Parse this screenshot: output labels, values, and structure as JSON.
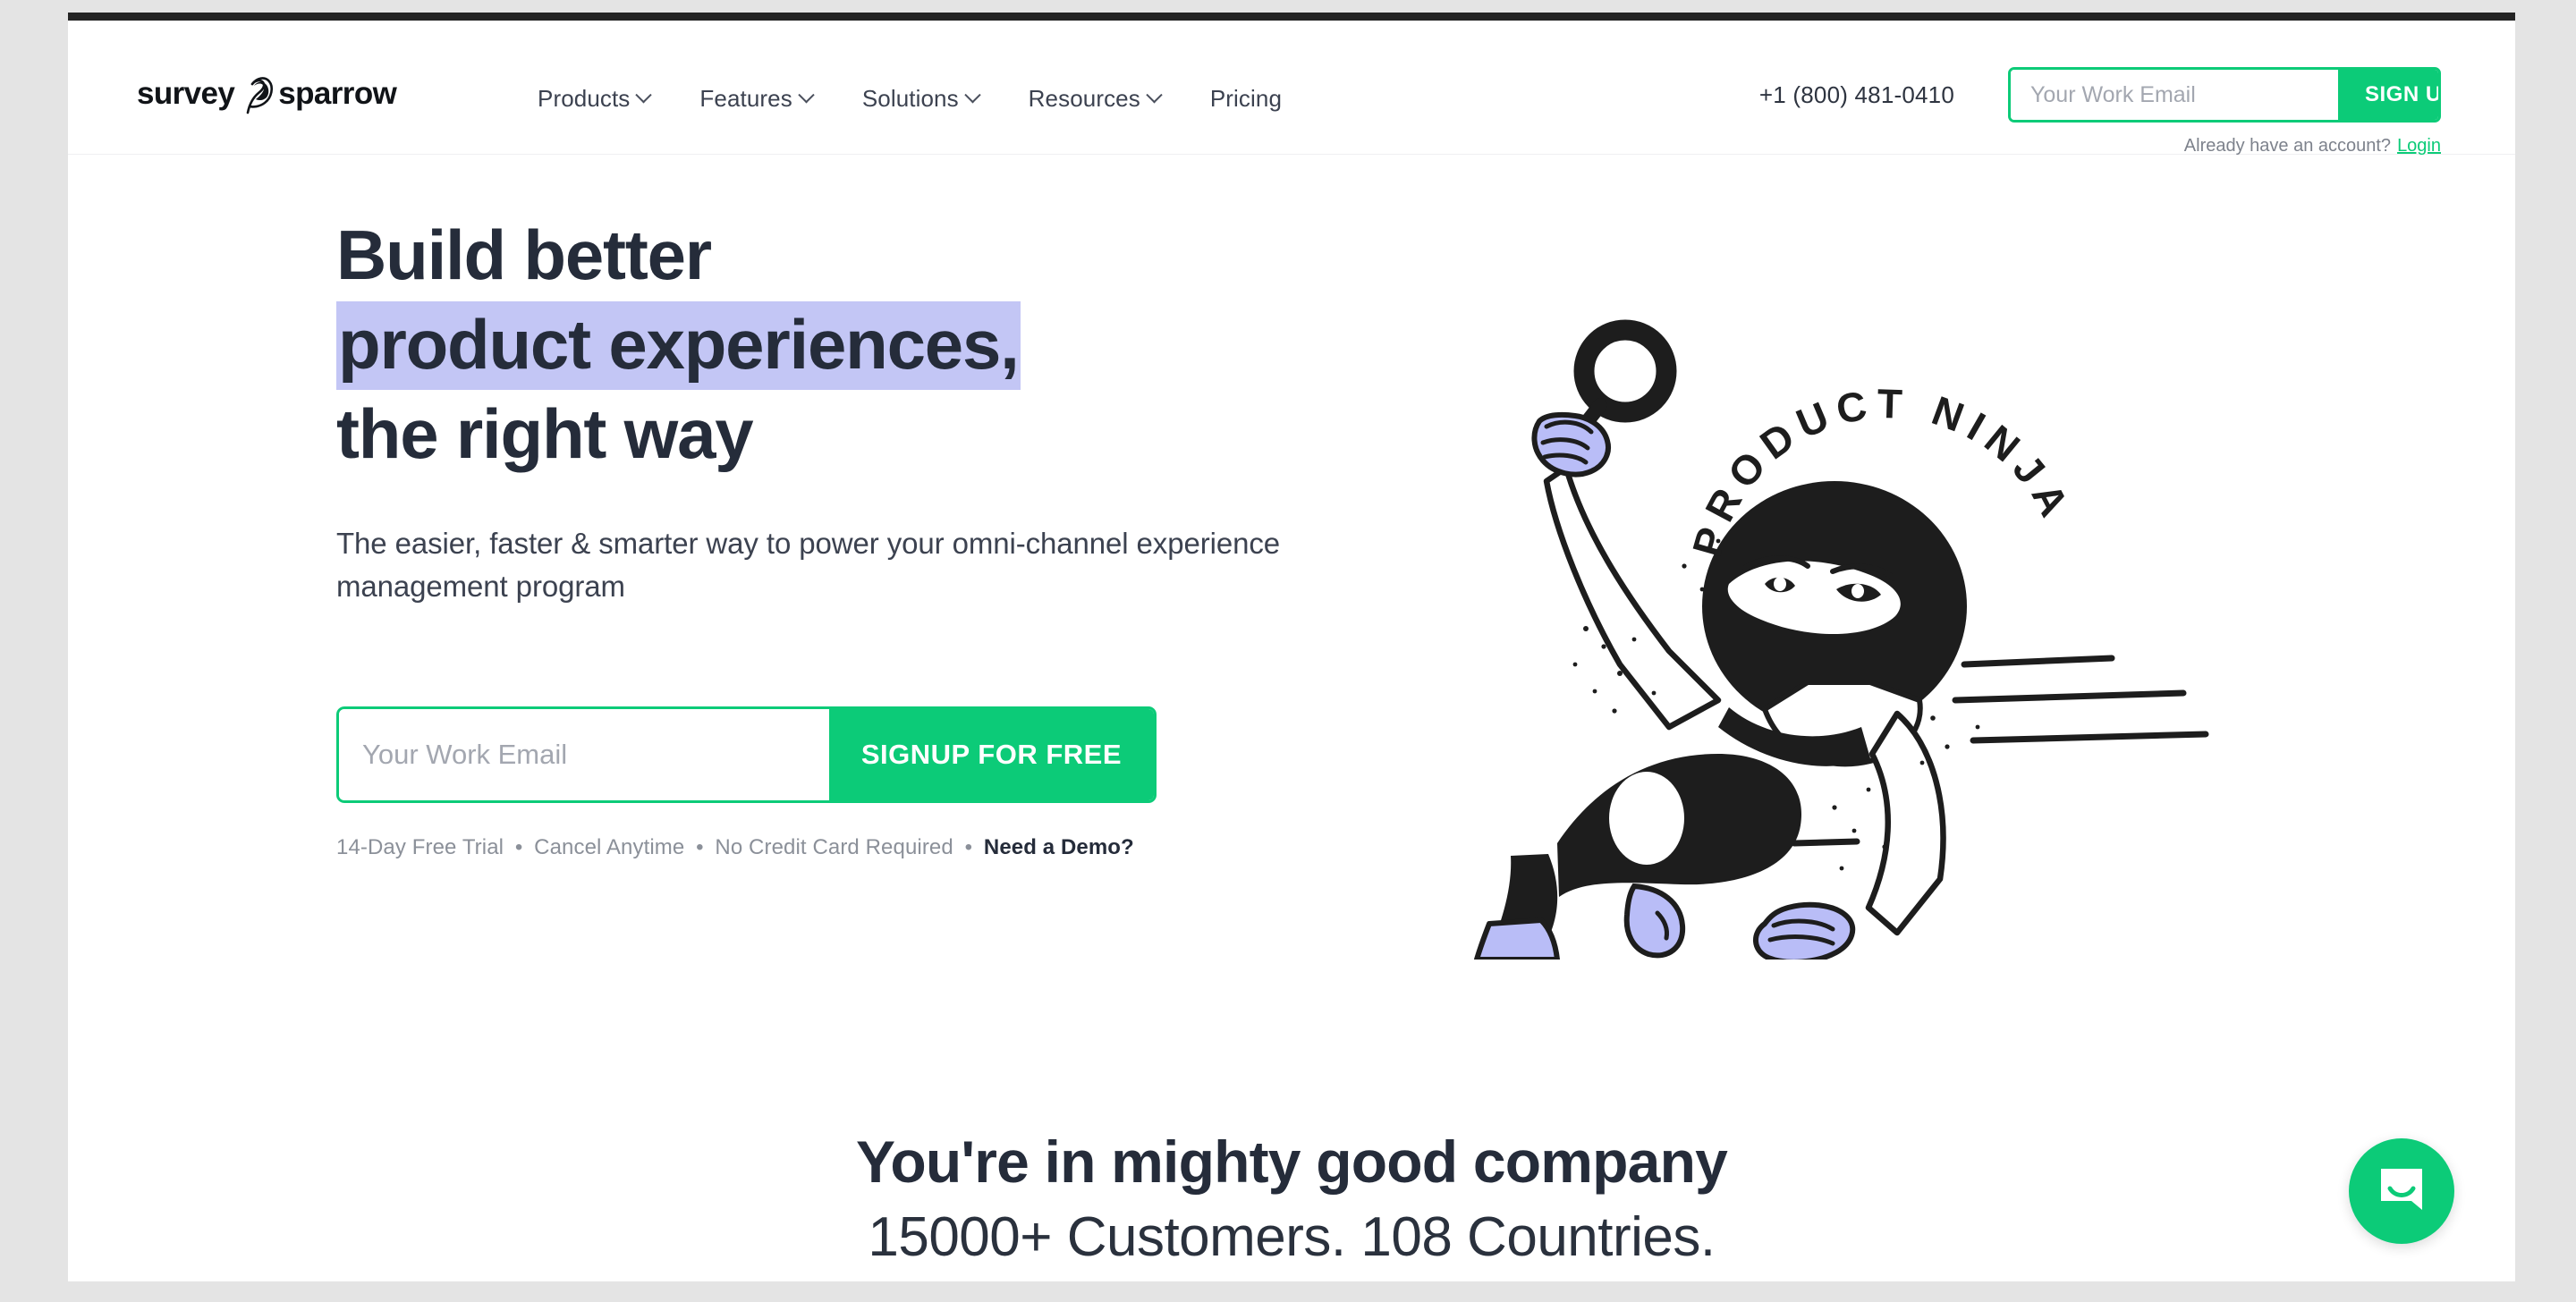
{
  "brand": {
    "logo_text_left": "survey",
    "logo_text_right": "sparrow",
    "logo_mark_name": "sparrow-swirl-mark",
    "accent_green": "#0ccb78",
    "highlight_lavender": "#c3c6f5",
    "heading_navy": "#252c3a"
  },
  "header": {
    "nav": [
      {
        "label": "Products",
        "has_chevron": true
      },
      {
        "label": "Features",
        "has_chevron": true
      },
      {
        "label": "Solutions",
        "has_chevron": true
      },
      {
        "label": "Resources",
        "has_chevron": true
      },
      {
        "label": "Pricing",
        "has_chevron": false
      }
    ],
    "phone": "+1 (800) 481-0410",
    "email_placeholder": "Your Work Email",
    "email_value": "",
    "signup_label": "SIGN UP",
    "already_text": "Already have an account?",
    "login_label": "Login"
  },
  "hero": {
    "headline_line1": "Build better",
    "headline_line2_highlight": "product experiences,",
    "headline_line3": "the right way",
    "subheadline": "The easier, faster & smarter way to power your omni-channel experience management program",
    "cta_placeholder": "Your Work Email",
    "cta_value": "",
    "cta_button": "SIGNUP FOR FREE",
    "trial_part1": "14-Day Free Trial",
    "trial_part2": "Cancel Anytime",
    "trial_part3": "No Credit Card Required",
    "trial_demo": "Need a Demo?",
    "trial_separator": "•",
    "illustration": {
      "name": "product-ninja-illustration",
      "arc_text": "PRODUCT NINJA",
      "description": "Ninja character running with a magnifying glass, lavender gloves and boots, motion speed lines"
    }
  },
  "social_proof": {
    "title": "You're in mighty good company",
    "subtitle": "15000+ Customers. 108 Countries."
  },
  "chat": {
    "icon_name": "intercom-chat-icon",
    "label": "Open chat"
  }
}
